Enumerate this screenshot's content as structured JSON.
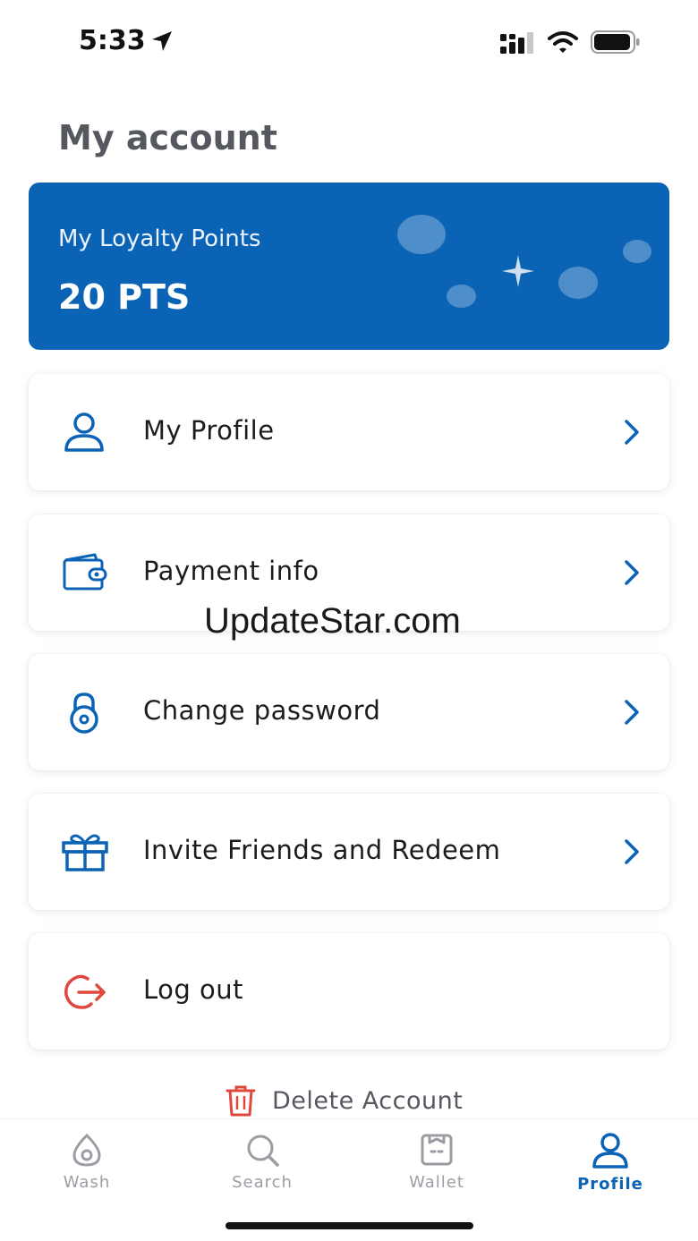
{
  "status_bar": {
    "time": "5:33"
  },
  "header": {
    "title": "My account"
  },
  "loyalty": {
    "label": "My Loyalty Points",
    "points": "20 PTS"
  },
  "menu": {
    "items": [
      {
        "label": "My Profile",
        "icon": "user-icon"
      },
      {
        "label": "Payment info",
        "icon": "wallet-icon"
      },
      {
        "label": "Change password",
        "icon": "lock-icon"
      },
      {
        "label": "Invite Friends and Redeem",
        "icon": "gift-icon"
      },
      {
        "label": "Log out",
        "icon": "logout-icon"
      }
    ]
  },
  "delete_account": {
    "label": "Delete Account"
  },
  "watermark": "UpdateStar.com",
  "tabs": [
    {
      "label": "Wash",
      "icon": "wash-icon",
      "active": false
    },
    {
      "label": "Search",
      "icon": "search-icon",
      "active": false
    },
    {
      "label": "Wallet",
      "icon": "wallet-tab-icon",
      "active": false
    },
    {
      "label": "Profile",
      "icon": "profile-icon",
      "active": true
    }
  ],
  "colors": {
    "brand_blue": "#0b63b6",
    "logout_red": "#e0483e",
    "title_gray": "#55595f",
    "inactive_tab": "#9a9ea4"
  }
}
